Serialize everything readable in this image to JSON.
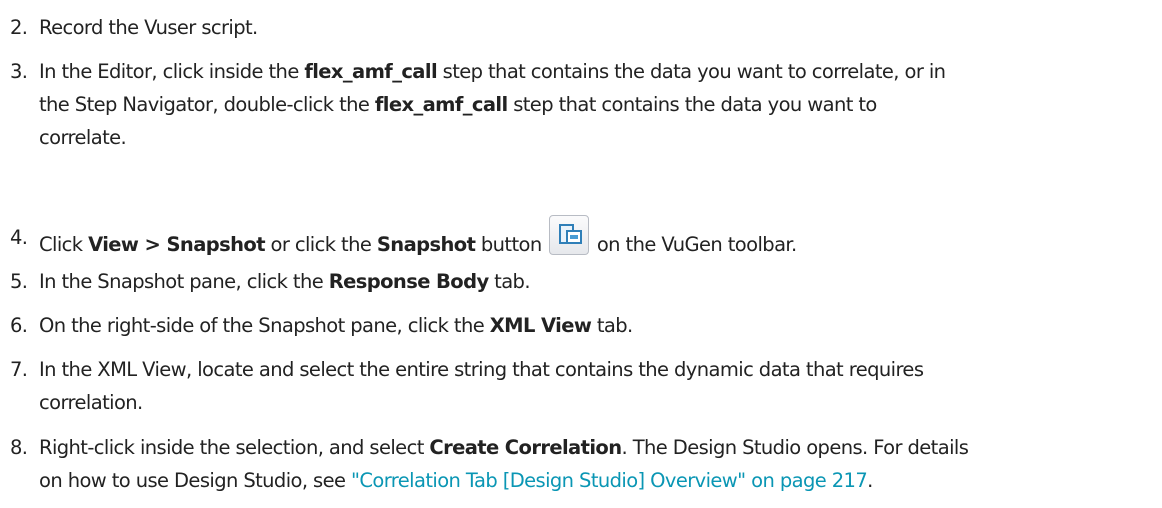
{
  "steps": [
    {
      "num": "2.",
      "text": "Record the Vuser script."
    },
    {
      "num": "3.",
      "line1_a": "In the Editor, click inside the ",
      "bold1": "flex_amf_call",
      "line1_b": " step that contains the data you want to correlate, or in",
      "line2_a": "the Step Navigator, double-click the ",
      "bold2": "flex_amf_call",
      "line2_b": " step that contains the data you want to",
      "line3": "correlate."
    },
    {
      "num": "4.",
      "a": "Click ",
      "bold1": "View > Snapshot",
      "b": " or click the ",
      "bold2": "Snapshot",
      "c": " button",
      "icon": "snapshot-icon",
      "d": " on the VuGen toolbar."
    },
    {
      "num": "5.",
      "a": "In the Snapshot pane, click the ",
      "bold": "Response Body",
      "b": " tab."
    },
    {
      "num": "6.",
      "a": "On the right-side of the Snapshot pane, click the ",
      "bold": "XML View",
      "b": " tab."
    },
    {
      "num": "7.",
      "line1": "In the XML View, locate and select the entire string that contains the dynamic data that requires",
      "line2": "correlation."
    },
    {
      "num": "8.",
      "a": "Right-click inside the selection, and select ",
      "bold": "Create Correlation",
      "b": ". The Design Studio opens. For details",
      "line2_a": "on how to use Design Studio, see ",
      "link": "\"Correlation Tab [Design Studio] Overview\" on page 217",
      "line2_b": "."
    }
  ],
  "colors": {
    "text": "#222222",
    "link": "#0a96b4"
  }
}
